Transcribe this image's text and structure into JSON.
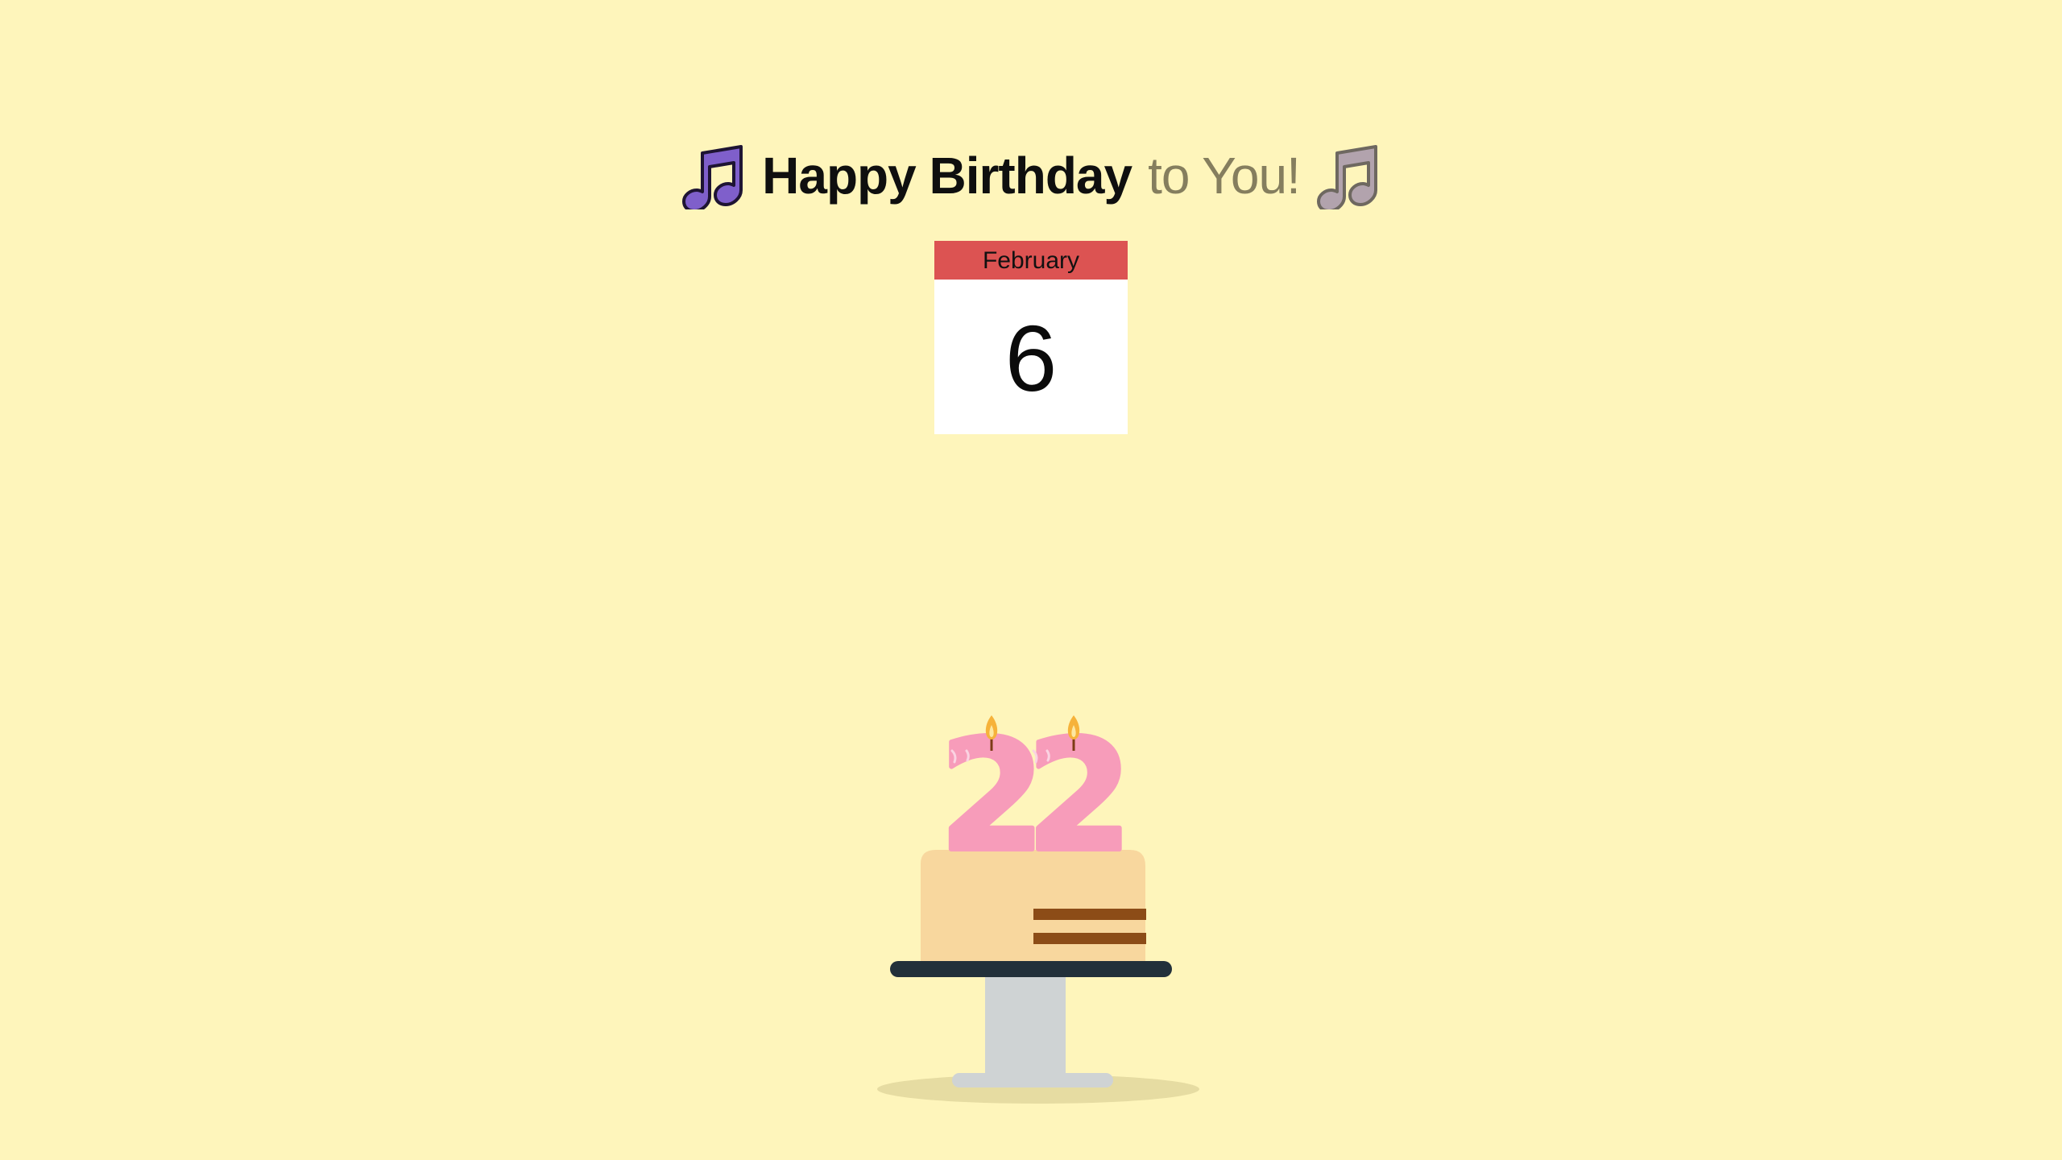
{
  "greeting": {
    "strong": "Happy Birthday",
    "soft": "to You!",
    "left_icon": "music-note-icon",
    "right_icon": "music-note-icon"
  },
  "calendar": {
    "month": "February",
    "day": "6"
  },
  "cake": {
    "age": "22"
  },
  "colors": {
    "background": "#fef5bb",
    "note_left": "#7f5fcb",
    "note_right": "#b2a3ad",
    "calendar_header": "#dc5352",
    "candle": "#f79cba",
    "cake": "#f8d79e",
    "cake_stripe": "#8c4c17",
    "plate": "#22303a",
    "stand": "#cfd3d4"
  }
}
